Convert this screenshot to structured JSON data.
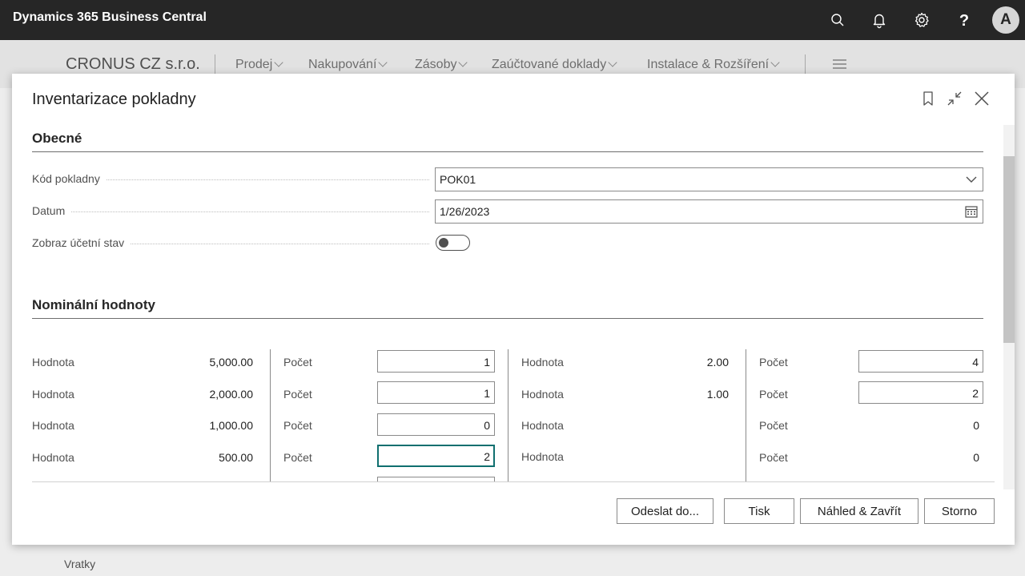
{
  "app": {
    "title": "Dynamics 365 Business Central",
    "avatar_initial": "A"
  },
  "topbar_icons": [
    "search-icon",
    "bell-icon",
    "gear-icon",
    "help-icon"
  ],
  "background": {
    "company": "CRONUS CZ s.r.o.",
    "nav": [
      "Prodej",
      "Nakupování",
      "Zásoby",
      "Zaúčtované doklady",
      "Instalace & Rozšíření"
    ],
    "footer_item": "Vratky"
  },
  "dialog": {
    "title": "Inventarizace pokladny",
    "general": {
      "title": "Obecné",
      "cash_desk_label": "Kód pokladny",
      "cash_desk_value": "POK01",
      "date_label": "Datum",
      "date_value": "1/26/2023",
      "show_balance_label": "Zobraz účetní stav",
      "show_balance_on": false
    },
    "nominal": {
      "title": "Nominální hodnoty",
      "value_label": "Hodnota",
      "count_label": "Počet",
      "left_rows": [
        {
          "value": "5,000.00",
          "count": "1"
        },
        {
          "value": "2,000.00",
          "count": "1"
        },
        {
          "value": "1,000.00",
          "count": "0"
        },
        {
          "value": "500.00",
          "count": "2"
        }
      ],
      "right_rows": [
        {
          "value": "2.00",
          "count": "4"
        },
        {
          "value": "1.00",
          "count": "2"
        },
        {
          "value": "",
          "count": "0"
        },
        {
          "value": "",
          "count": "0"
        }
      ]
    },
    "buttons": {
      "send": "Odeslat do...",
      "print": "Tisk",
      "preview_close": "Náhled & Zavřít",
      "cancel": "Storno"
    }
  },
  "colors": {
    "topbar": "#262626",
    "accent_focus": "#0f6f6f"
  }
}
